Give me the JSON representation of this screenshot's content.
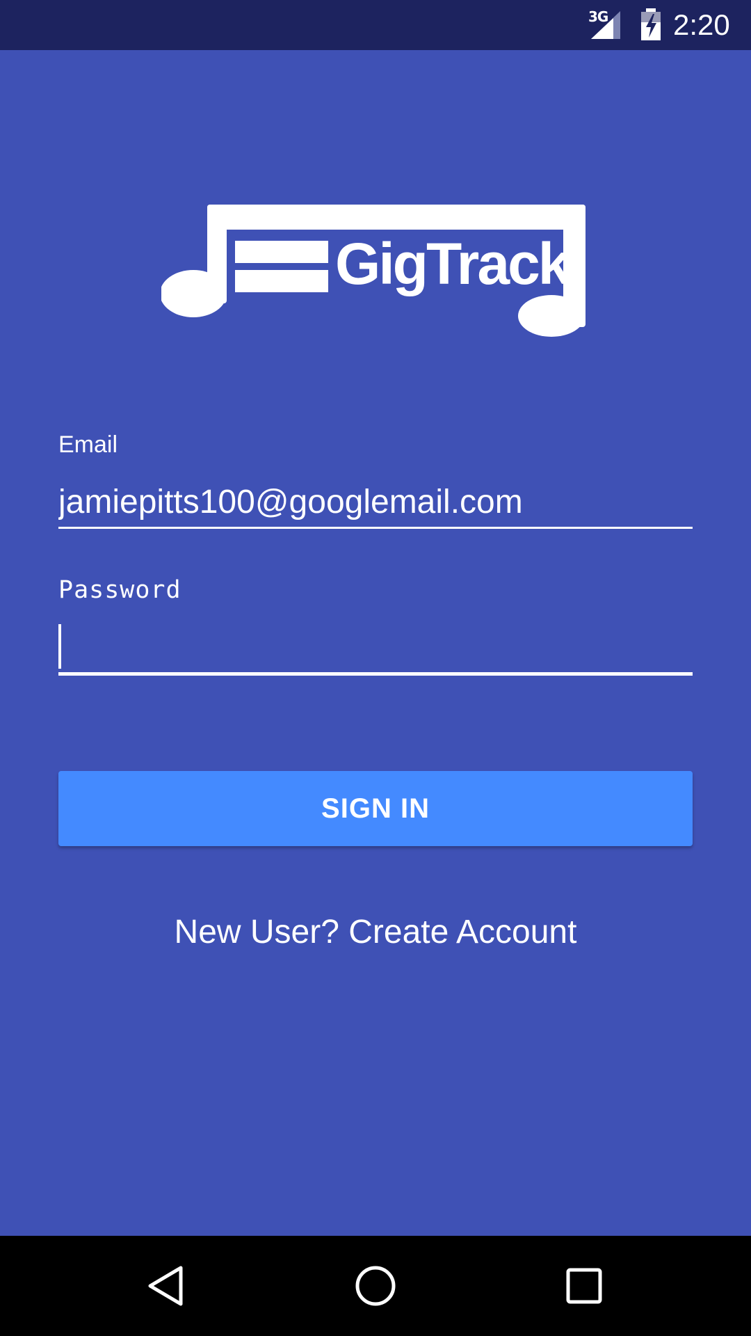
{
  "status_bar": {
    "network_type": "3G",
    "signal_icon": "cell-signal-icon",
    "battery_icon": "battery-charging-icon",
    "time": "2:20",
    "background_color": "#1d235f"
  },
  "app": {
    "logo_text": "GigTrack",
    "logo_icon": "music-note-logo-icon",
    "background_color": "#3f51b5"
  },
  "form": {
    "email": {
      "label": "Email",
      "value": "jamiepitts100@googlemail.com"
    },
    "password": {
      "label": "Password",
      "value": ""
    },
    "sign_in_label": "SIGN IN",
    "sign_in_color": "#448aff",
    "create_account_label": "New User? Create Account"
  },
  "nav_bar": {
    "back_icon": "back-triangle-icon",
    "home_icon": "home-circle-icon",
    "recents_icon": "recents-square-icon"
  }
}
